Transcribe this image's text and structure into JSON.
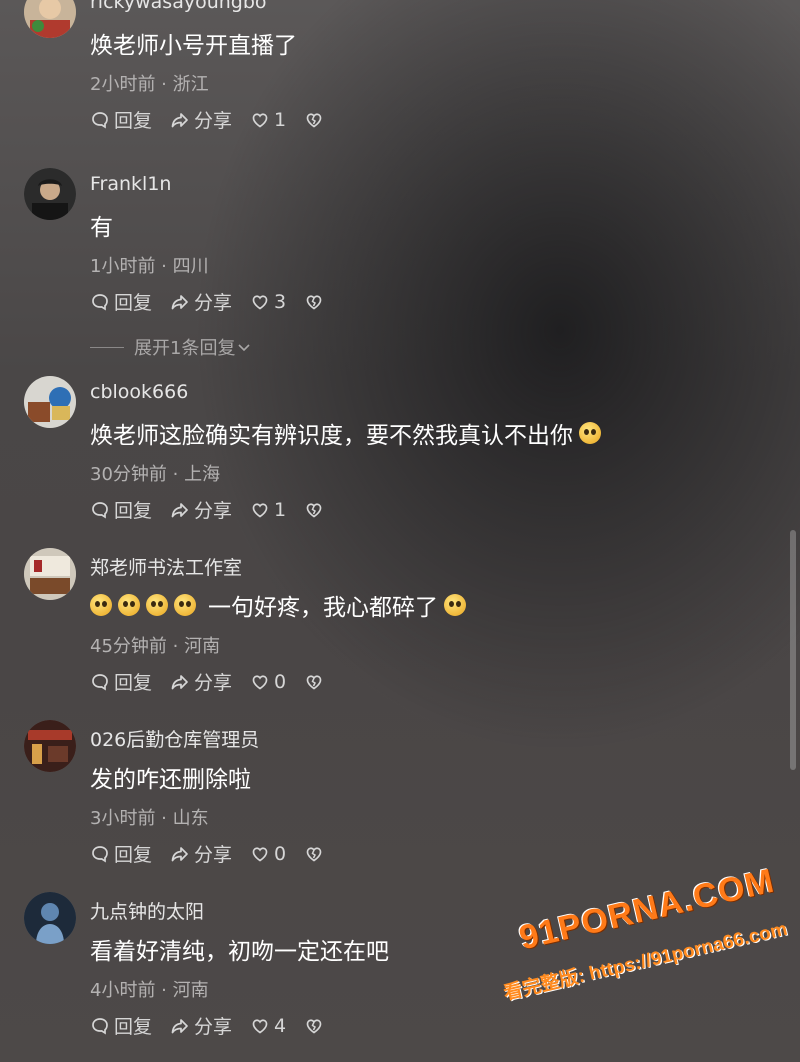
{
  "comments": [
    {
      "username": "rickywasayoungbo",
      "content": "焕老师小号开直播了",
      "meta": "2小时前 · 浙江",
      "reply_label": "回复",
      "share_label": "分享",
      "likes": "1"
    },
    {
      "username": "Frankl1n",
      "content": "有",
      "meta": "1小时前 · 四川",
      "reply_label": "回复",
      "share_label": "分享",
      "likes": "3",
      "expand_replies_label": "展开1条回复"
    },
    {
      "username": "cblook666",
      "content": "焕老师这脸确实有辨识度，要不然我真认不出你",
      "meta": "30分钟前 · 上海",
      "reply_label": "回复",
      "share_label": "分享",
      "likes": "1"
    },
    {
      "username": "郑老师书法工作室",
      "content": "一句好疼，我心都碎了",
      "meta": "45分钟前 · 河南",
      "reply_label": "回复",
      "share_label": "分享",
      "likes": "0"
    },
    {
      "username": "026后勤仓库管理员",
      "content": "发的咋还删除啦",
      "meta": "3小时前 · 山东",
      "reply_label": "回复",
      "share_label": "分享",
      "likes": "0"
    },
    {
      "username": "九点钟的太阳",
      "content": "看着好清纯，初吻一定还在吧",
      "meta": "4小时前 · 河南",
      "reply_label": "回复",
      "share_label": "分享",
      "likes": "4"
    }
  ],
  "icons": {
    "reply": "comment-bubble-icon",
    "share": "share-arrow-icon",
    "like": "heart-icon",
    "dislike": "broken-heart-icon",
    "expand": "chevron-down-icon"
  },
  "watermark": {
    "logo": "91PORNA.COM",
    "url": "看完整版: https://91porna66.com"
  },
  "colors": {
    "text_primary": "#ffffff",
    "text_secondary": "#b4b2b2",
    "watermark": "#ff7a18"
  }
}
